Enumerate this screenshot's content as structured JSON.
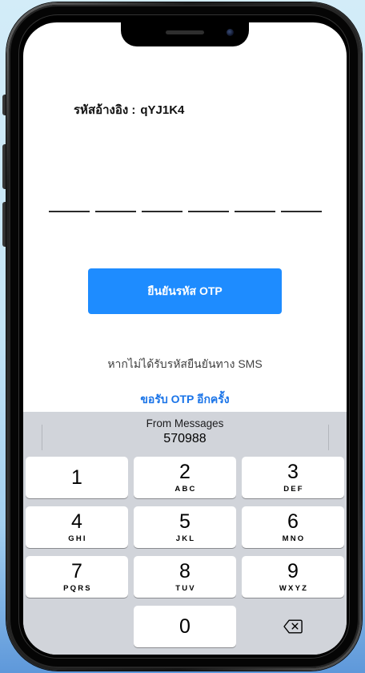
{
  "colors": {
    "page_background": "#c4e4f5",
    "phone_frame": "#1d1d1d",
    "screen_background": "#ffffff",
    "primary_button": "#1e8cff",
    "button_text": "#ffffff",
    "link": "#1a74e8",
    "body_text": "#111111",
    "secondary_text": "#404040",
    "keyboard_background": "#d1d4da",
    "key_background": "#ffffff"
  },
  "otp": {
    "reference_label": "รหัสอ้างอิง :",
    "reference_code": "qYJ1K4",
    "digit_slots": [
      "",
      "",
      "",
      "",
      "",
      ""
    ],
    "confirm_button_label": "ยืนยันรหัส OTP",
    "no_sms_text": "หากไม่ได้รับรหัสยืนยันทาง SMS",
    "resend_link_label": "ขอรับ OTP อีกครั้ง"
  },
  "keyboard": {
    "suggestion": {
      "source": "From Messages",
      "code": "570988"
    },
    "rows": [
      [
        {
          "digit": "1"
        },
        {
          "digit": "2",
          "letters": "ABC"
        },
        {
          "digit": "3",
          "letters": "DEF"
        }
      ],
      [
        {
          "digit": "4",
          "letters": "GHI"
        },
        {
          "digit": "5",
          "letters": "JKL"
        },
        {
          "digit": "6",
          "letters": "MNO"
        }
      ],
      [
        {
          "digit": "7",
          "letters": "PQRS"
        },
        {
          "digit": "8",
          "letters": "TUV"
        },
        {
          "digit": "9",
          "letters": "WXYZ"
        }
      ]
    ],
    "zero_key": "0",
    "delete_key_icon": "backspace-icon"
  }
}
